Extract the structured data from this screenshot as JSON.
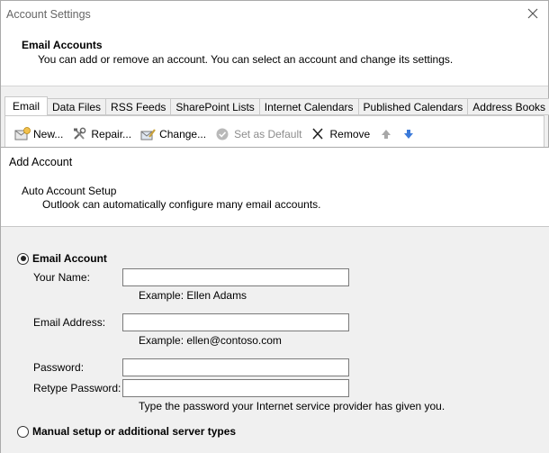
{
  "account_settings": {
    "title": "Account Settings",
    "heading": "Email Accounts",
    "description": "You can add or remove an account. You can select an account and change its settings.",
    "tabs": [
      {
        "label": "Email",
        "active": true
      },
      {
        "label": "Data Files"
      },
      {
        "label": "RSS Feeds"
      },
      {
        "label": "SharePoint Lists"
      },
      {
        "label": "Internet Calendars"
      },
      {
        "label": "Published Calendars"
      },
      {
        "label": "Address Books"
      }
    ],
    "toolbar": {
      "new_label": "New...",
      "repair_label": "Repair...",
      "change_label": "Change...",
      "set_default_label": "Set as Default",
      "remove_label": "Remove"
    }
  },
  "add_account": {
    "title": "Add Account",
    "heading": "Auto Account Setup",
    "description": "Outlook can automatically configure many email accounts.",
    "email_account_option": "Email Account",
    "manual_option": "Manual setup or additional server types",
    "selected_option": "email_account",
    "fields": {
      "your_name_label": "Your Name:",
      "your_name_value": "",
      "your_name_hint": "Example: Ellen Adams",
      "email_label": "Email Address:",
      "email_value": "",
      "email_hint": "Example: ellen@contoso.com",
      "password_label": "Password:",
      "password_value": "",
      "retype_label": "Retype Password:",
      "retype_value": "",
      "password_hint": "Type the password your Internet service provider has given you."
    }
  },
  "colors": {
    "window_bg": "#f0f0f0",
    "panel_bg": "#ffffff",
    "disabled_text": "#8c8c8c",
    "arrow_blue": "#3b7ad9"
  }
}
